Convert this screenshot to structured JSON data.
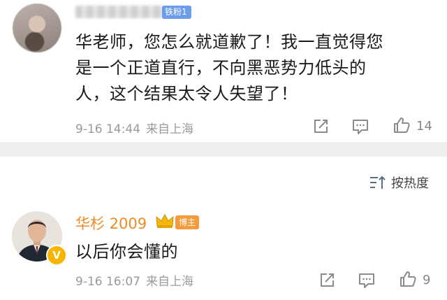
{
  "comment1": {
    "fan_badge": "铁粉1",
    "lines": [
      "华老师，您怎么就道歉了！我一直觉得您",
      "是一个正道直行，不向黑恶势力低头的",
      "人，这个结果太令人失望了！"
    ],
    "time": "9-16 14:44",
    "source": "来自上海",
    "likes": "14",
    "icons": [
      "share-icon",
      "comment-icon",
      "like-icon"
    ]
  },
  "sort": {
    "label": "按热度",
    "icon": "sort-icon"
  },
  "comment2": {
    "username": "华杉 2009",
    "crown_badge": "crown-icon",
    "host_badge": "博主",
    "verified_badge": "V",
    "text": "以后你会懂的",
    "time": "9-16 16:07",
    "source": "来自上海",
    "likes": "9",
    "icons": [
      "share-icon",
      "comment-icon",
      "like-icon"
    ]
  },
  "colors": {
    "username_orange": "#f08a23",
    "fan_badge_blue": "#6c9ceb",
    "host_badge_orange": "#f59b3d",
    "divider_gray": "#efefef"
  }
}
